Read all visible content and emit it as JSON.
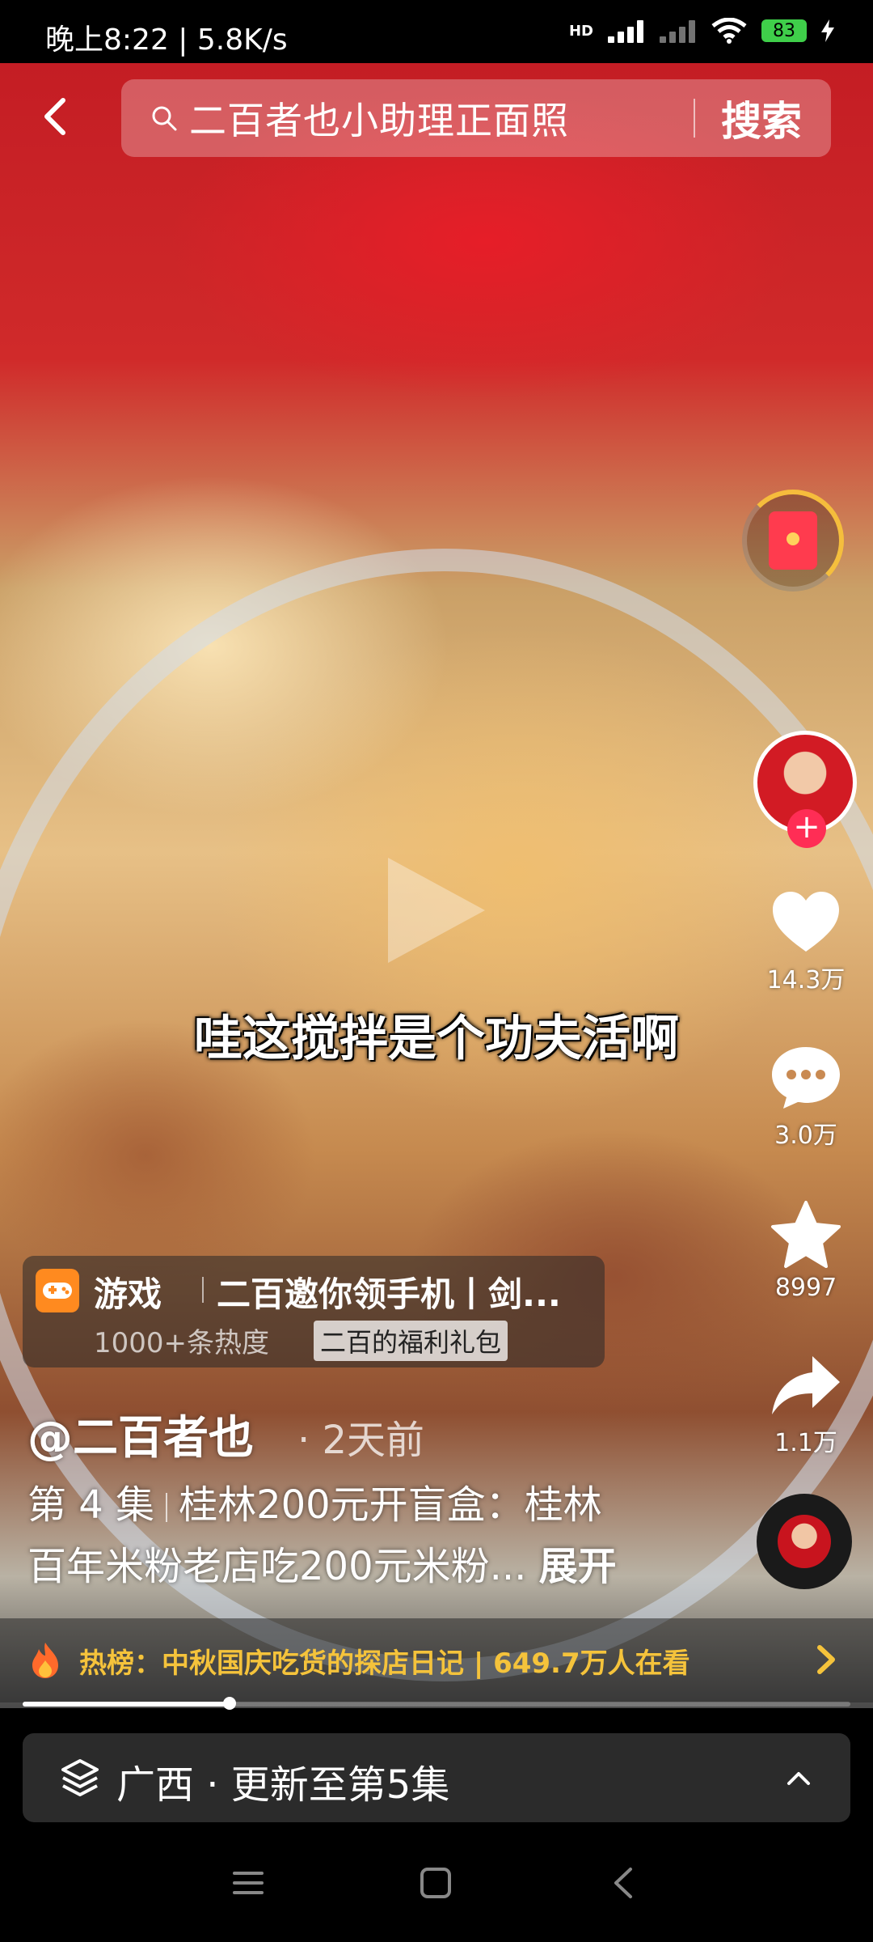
{
  "status_bar": {
    "time_speed": "晚上8:22 | 5.8K/s",
    "network": "HD",
    "battery": "83"
  },
  "search": {
    "query": "二百者也小助理正面照",
    "button": "搜索"
  },
  "video": {
    "caption": "哇这搅拌是个功夫活啊"
  },
  "actions": {
    "likes": "14.3万",
    "comments": "3.0万",
    "favorites": "8997",
    "shares": "1.1万"
  },
  "game_card": {
    "tag": "游戏",
    "title": "二百邀你领手机丨剑...",
    "heat": "1000+条热度",
    "gift": "二百的福利礼包"
  },
  "post": {
    "author": "@二百者也",
    "time": "· 2天前",
    "episode": "第 4 集",
    "description_line1": "桂林200元开盲盒：桂林",
    "description_line2": "百年米粉老店吃200元米粉...",
    "expand": "展开"
  },
  "hot": {
    "text": "热榜：中秋国庆吃货的探店日记 | 649.7万人在看"
  },
  "progress": {
    "fraction": 0.25
  },
  "series": {
    "text": "广西 · 更新至第5集"
  },
  "colors": {
    "hot_text": "#f5c33b",
    "follow_plus": "#ff2d55",
    "game_icon": "#ff8a1f"
  }
}
